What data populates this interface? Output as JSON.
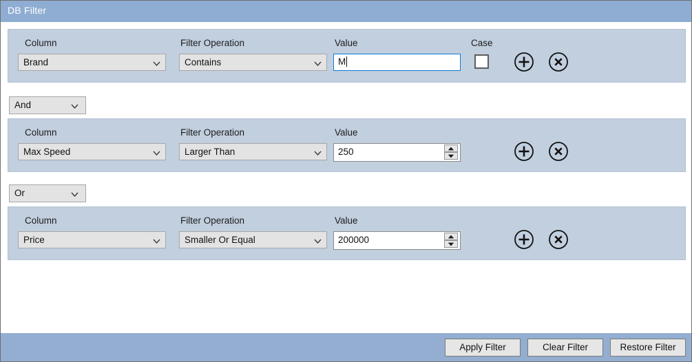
{
  "window": {
    "title": "DB Filter"
  },
  "labels": {
    "column": "Column",
    "filter_operation": "Filter Operation",
    "value": "Value",
    "case": "Case"
  },
  "icons": {
    "chevron_down": "chevron-down-icon",
    "spin_up": "spinner-up-icon",
    "spin_down": "spinner-down-icon",
    "add": "circle-plus-icon",
    "remove": "circle-x-icon"
  },
  "filter_rows": [
    {
      "column": "Brand",
      "operation": "Contains",
      "value": "M",
      "value_type": "text",
      "case_sensitive": false,
      "has_case_checkbox": true
    },
    {
      "column": "Max Speed",
      "operation": "Larger Than",
      "value": "250",
      "value_type": "number",
      "has_case_checkbox": false
    },
    {
      "column": "Price",
      "operation": "Smaller Or Equal",
      "value": "200000",
      "value_type": "number",
      "has_case_checkbox": false
    }
  ],
  "connectors": [
    {
      "value": "And"
    },
    {
      "value": "Or"
    }
  ],
  "footer": {
    "apply_label": "Apply Filter",
    "clear_label": "Clear Filter",
    "restore_label": "Restore Filter"
  },
  "colors": {
    "titlebar": "#8fadd2",
    "footer": "#93aed0",
    "row_panel": "#c1cfdf",
    "control_face": "#e3e3e3",
    "focus_border": "#0a7cd8"
  }
}
